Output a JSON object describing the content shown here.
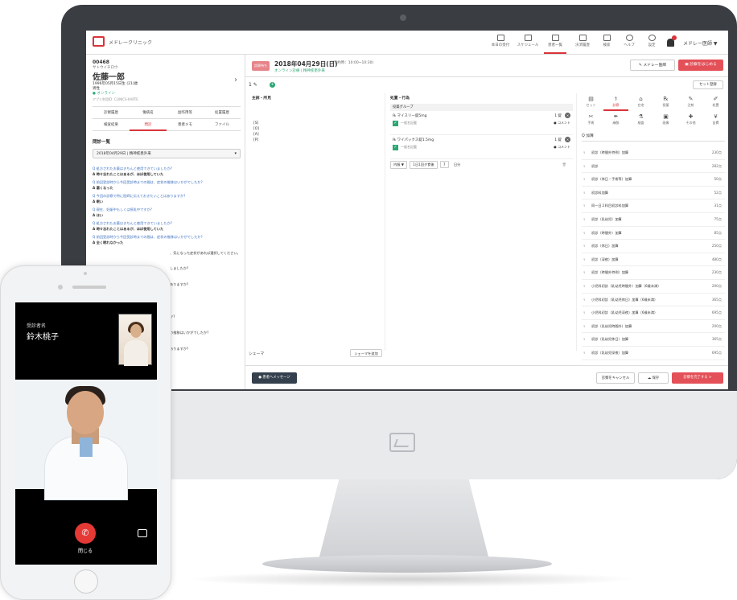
{
  "header": {
    "brand": "メドレークリニック",
    "nav": [
      {
        "label": "本日の受付",
        "active": false
      },
      {
        "label": "スケジュール",
        "active": false
      },
      {
        "label": "患者一覧",
        "active": true
      },
      {
        "label": "決済履歴",
        "active": false
      },
      {
        "label": "検索",
        "active": false
      },
      {
        "label": "ヘルプ",
        "active": false
      },
      {
        "label": "設定",
        "active": false
      }
    ],
    "notification_count": "9",
    "user": "メドレー医師 ▼"
  },
  "patient": {
    "id": "00468",
    "kana": "サトウイチロウ",
    "name": "佐藤一郎",
    "dob": "1996年05月15日生 (21)歳",
    "sex": "男性",
    "status": "● オンライン",
    "app_id": "アプリ利用ID: CLINICS-KARTE",
    "tabs": [
      {
        "label": "診察履歴",
        "active": false
      },
      {
        "label": "傷病名",
        "active": false
      },
      {
        "label": "副作用等",
        "active": false
      },
      {
        "label": "処置履歴",
        "active": false
      },
      {
        "label": "検査結果",
        "active": false
      },
      {
        "label": "問診",
        "active": true
      },
      {
        "label": "患者メモ",
        "active": false
      },
      {
        "label": "ファイル",
        "active": false
      }
    ]
  },
  "questionnaire": {
    "title": "問診一覧",
    "selected": "2018年04月29日 | 精神疾患外来",
    "items": [
      {
        "q": "Q 処方されたお薬はきちんと使用できていましたか?",
        "a": "A 時々忘れたことはあるが、ほぼ使用していた"
      },
      {
        "q": "Q 前回受診時から今回受診時までの間は、症状の推移はいかがでしたか?",
        "a": "A 悪くなった"
      },
      {
        "q": "Q 今回の診察で特に医師に伝えておきたいことはありますか?",
        "a": "A 眠い"
      },
      {
        "q": "Q 現在、妊娠中もしくは授乳中ですか?",
        "a": "A はい"
      },
      {
        "q": "Q 処方されたお薬はきちんと使用できていましたか?",
        "a": "A 時々忘れたことはあるが、ほぼ使用していた"
      },
      {
        "q": "Q 前回受診時から今回受診時までの間は、症状の推移はいかがでしたか?",
        "a": "A 全く眠れなかった"
      }
    ],
    "partial": [
      "、気になった症状があれば選択してください。",
      "しましたか?",
      "ありますか?",
      "か?",
      "の推移はいかがでしたか?",
      "ありますか?"
    ]
  },
  "visit": {
    "badge": "診察待ち",
    "date": "2018年04月29日(日)",
    "time": "(予約時：10:00~10:30)",
    "type": "オンライン診療 | 精神疾患外来",
    "doctor_button": "メドレー医師",
    "start_button": "診察をはじめる",
    "index": "1",
    "set_button": "セット登録"
  },
  "record": {
    "complaint_title": "主訴・所見",
    "soap": [
      "[S]",
      "[O]",
      "[A]",
      "[P]"
    ],
    "schema_title": "シェーマ",
    "schema_button": "シェーマを追加"
  },
  "orders": {
    "title": "処置・行為",
    "group": "投薬グループ",
    "prescriptions": [
      {
        "name": "マイスリー錠5mg",
        "qty": "1 錠",
        "memo": "一般名記載",
        "comment": "コメント"
      },
      {
        "name": "ワイパックス錠1.5mg",
        "qty": "1 錠",
        "memo": "一般名記載",
        "comment": "コメント"
      }
    ],
    "dose": {
      "route": "内服 ▼",
      "freq": "1日1回夕食後",
      "days": "7",
      "unit": "日分"
    }
  },
  "order_tools": [
    {
      "label": "セット",
      "glyph": "▤",
      "active": false
    },
    {
      "label": "診察",
      "glyph": "⚕",
      "active": true
    },
    {
      "label": "在宅",
      "glyph": "⌂",
      "active": false
    },
    {
      "label": "投薬",
      "glyph": "℞",
      "active": false
    },
    {
      "label": "注射",
      "glyph": "✎",
      "active": false
    },
    {
      "label": "処置",
      "glyph": "✐",
      "active": false
    },
    {
      "label": "手術",
      "glyph": "✂",
      "active": false
    },
    {
      "label": "麻酔",
      "glyph": "✒",
      "active": false
    },
    {
      "label": "検査",
      "glyph": "⚗",
      "active": false
    },
    {
      "label": "画像",
      "glyph": "▣",
      "active": false
    },
    {
      "label": "その他",
      "glyph": "✚",
      "active": false
    },
    {
      "label": "自費",
      "glyph": "¥",
      "active": false
    }
  ],
  "fees_search": "Q 加算",
  "fees": [
    {
      "name": "初診（時間外特例）加算",
      "points": "230点"
    },
    {
      "name": "初診",
      "points": "282点"
    },
    {
      "name": "初診（休日・手術等）加算",
      "points": "50点"
    },
    {
      "name": "初診料加算",
      "points": "52点"
    },
    {
      "name": "同一日２科目初診料加算",
      "points": "31点"
    },
    {
      "name": "初診（乳幼児）加算",
      "points": "75点"
    },
    {
      "name": "初診（時間外）加算",
      "points": "85点"
    },
    {
      "name": "初診（休日）加算",
      "points": "250点"
    },
    {
      "name": "初診（深夜）加算",
      "points": "480点"
    },
    {
      "name": "初診（時間外特例）加算",
      "points": "230点"
    },
    {
      "name": "小児科初診（乳幼児時間外）加算（6歳未満）",
      "points": "200点"
    },
    {
      "name": "小児科初診（乳幼児休日）加算（6歳未満）",
      "points": "365点"
    },
    {
      "name": "小児科初診（乳幼児深夜）加算（6歳未満）",
      "points": "695点"
    },
    {
      "name": "初診（乳幼児時間外）加算",
      "points": "200点"
    },
    {
      "name": "初診（乳幼児休日）加算",
      "points": "365点"
    },
    {
      "name": "初診（乳幼児深夜）加算",
      "points": "695点"
    }
  ],
  "footer": {
    "message_button": "患者へメッセージ",
    "cancel_button": "診察をキャンセル",
    "save_button": "保存",
    "finish_button": "診察を完了する >"
  },
  "phone": {
    "receiver_label": "受診者名",
    "receiver_name": "鈴木桃子",
    "end_label": "閉じる"
  }
}
